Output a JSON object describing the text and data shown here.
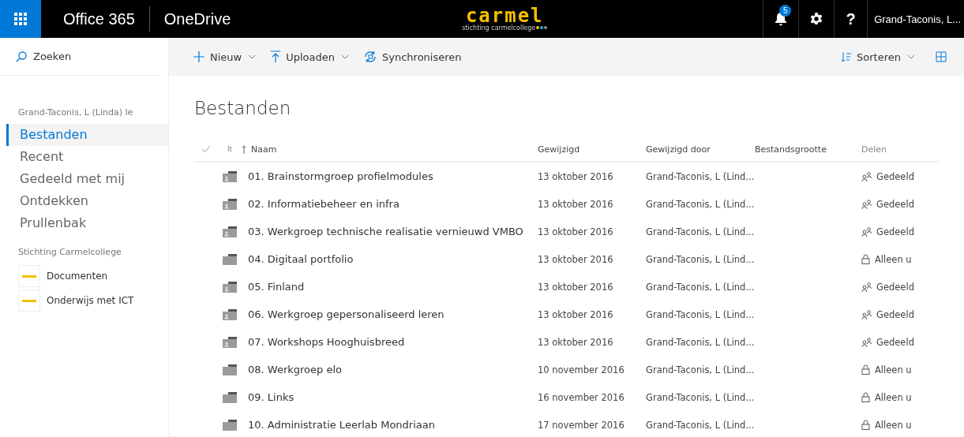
{
  "header": {
    "suite": "Office 365",
    "app": "OneDrive",
    "logo": {
      "word": "carmel",
      "tagline": "stichting carmelcollege"
    },
    "notifications": "5",
    "help": "?",
    "user": "Grand-Taconis, L..."
  },
  "search": {
    "placeholder": "Zoeken"
  },
  "toolbar": {
    "commands": [
      {
        "kind": "new",
        "label": "Nieuw",
        "dropdown": true
      },
      {
        "kind": "upload",
        "label": "Uploaden",
        "dropdown": true
      },
      {
        "kind": "sync",
        "label": "Synchroniseren",
        "dropdown": false
      }
    ],
    "sort": {
      "label": "Sorteren"
    }
  },
  "sidebar": {
    "owner": "Grand-Taconis, L (Linda) le",
    "items": [
      {
        "label": "Bestanden",
        "selected": true
      },
      {
        "label": "Recent",
        "selected": false
      },
      {
        "label": "Gedeeld met mij",
        "selected": false
      },
      {
        "label": "Ontdekken",
        "selected": false
      },
      {
        "label": "Prullenbak",
        "selected": false
      }
    ],
    "group": "Stichting Carmelcollege",
    "sites": [
      {
        "label": "Documenten"
      },
      {
        "label": "Onderwijs met ICT"
      }
    ]
  },
  "page_title": "Bestanden",
  "table": {
    "columns": {
      "type": "It",
      "name": "Naam",
      "modified": "Gewijzigd",
      "modified_by": "Gewijzigd door",
      "size": "Bestandsgrootte",
      "sharing": "Delen"
    },
    "rows": [
      {
        "name": "01. Brainstormgroep profielmodules",
        "modified": "13 oktober 2016",
        "modified_by": "Grand-Taconis, L (Lind...",
        "kind": "shared",
        "sharing": "Gedeeld"
      },
      {
        "name": "02. Informatiebeheer en infra",
        "modified": "13 oktober 2016",
        "modified_by": "Grand-Taconis, L (Lind...",
        "kind": "shared",
        "sharing": "Gedeeld"
      },
      {
        "name": "03. Werkgroep technische realisatie vernieuwd VMBO",
        "modified": "13 oktober 2016",
        "modified_by": "Grand-Taconis, L (Lind...",
        "kind": "shared",
        "sharing": "Gedeeld"
      },
      {
        "name": "04. Digitaal portfolio",
        "modified": "13 oktober 2016",
        "modified_by": "Grand-Taconis, L (Lind...",
        "kind": "private",
        "sharing": "Alleen u"
      },
      {
        "name": "05. Finland",
        "modified": "13 oktober 2016",
        "modified_by": "Grand-Taconis, L (Lind...",
        "kind": "shared",
        "sharing": "Gedeeld"
      },
      {
        "name": "06. Werkgroep gepersonaliseerd leren",
        "modified": "13 oktober 2016",
        "modified_by": "Grand-Taconis, L (Lind...",
        "kind": "shared",
        "sharing": "Gedeeld"
      },
      {
        "name": "07. Workshops Hooghuisbreed",
        "modified": "13 oktober 2016",
        "modified_by": "Grand-Taconis, L (Lind...",
        "kind": "shared",
        "sharing": "Gedeeld"
      },
      {
        "name": "08. Werkgroep elo",
        "modified": "10 november 2016",
        "modified_by": "Grand-Taconis, L (Lind...",
        "kind": "private",
        "sharing": "Alleen u"
      },
      {
        "name": "09. Links",
        "modified": "16 november 2016",
        "modified_by": "Grand-Taconis, L (Lind...",
        "kind": "private",
        "sharing": "Alleen u"
      },
      {
        "name": "10. Administratie Leerlab Mondriaan",
        "modified": "17 november 2016",
        "modified_by": "Grand-Taconis, L (Lind...",
        "kind": "private",
        "sharing": "Alleen u"
      }
    ]
  }
}
